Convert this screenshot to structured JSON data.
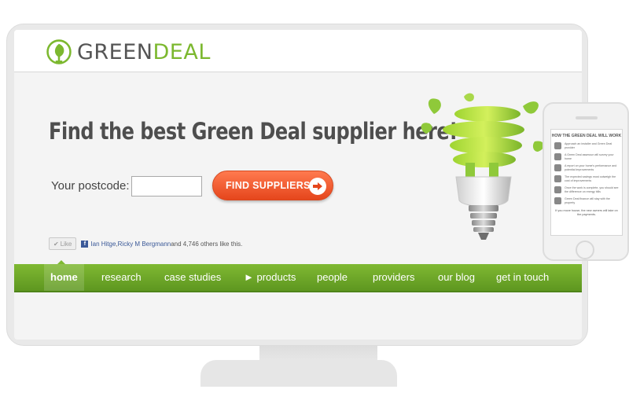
{
  "site": {
    "logo": {
      "part1": "GREEN",
      "part2": "DEAL"
    }
  },
  "hero": {
    "title": "Find the best Green Deal supplier here!",
    "postcode_label": "Your postcode:",
    "postcode_value": "",
    "find_button": "FIND SUPPLIERS"
  },
  "social": {
    "like_label": "Like",
    "name1": "Ian Hitge",
    "separator": ", ",
    "name2": "Ricky M Bergmann",
    "suffix": " and 4,746 others like this."
  },
  "nav": {
    "items": [
      {
        "label": "home",
        "active": true
      },
      {
        "label": "research"
      },
      {
        "label": "case studies"
      },
      {
        "label": "► products"
      },
      {
        "label": "people"
      },
      {
        "label": "providers"
      },
      {
        "label": "our blog"
      },
      {
        "label": "get in touch"
      }
    ]
  },
  "phone": {
    "title": "HOW THE GREEN DEAL WILL WORK",
    "rows": [
      "Approach an installer and Green Deal provider",
      "A Green Deal assessor will survey your home",
      "A report on your home's performance and potential improvements",
      "The expected savings must outweigh the cost of improvements",
      "Once the work is complete, you should see the difference on energy bills",
      "Green Deal finance will stay with the property"
    ],
    "footer": "If you move house, the new owners will take on the payments."
  },
  "colors": {
    "brand_green": "#7cb82f",
    "nav_green": "#6aa526",
    "cta_orange": "#ee5526",
    "text_dark": "#4e4e4e"
  }
}
